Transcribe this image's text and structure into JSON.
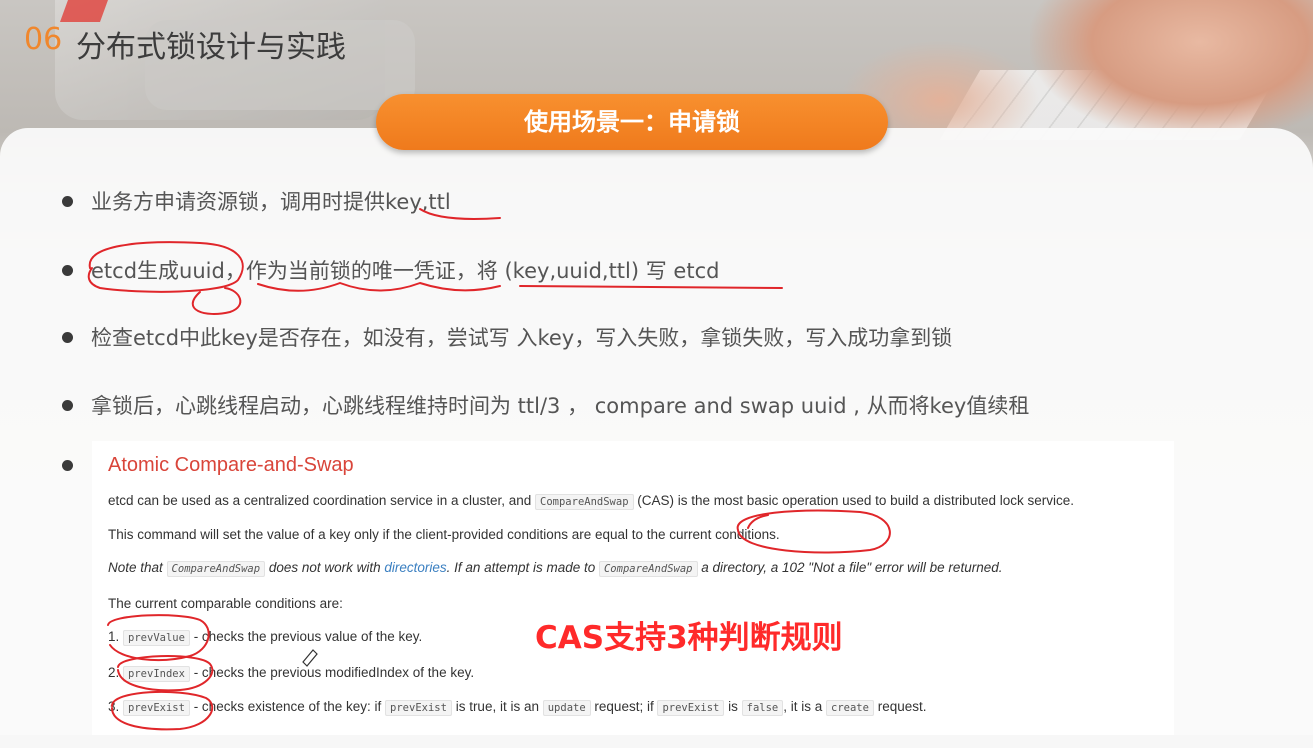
{
  "header": {
    "page_num": "06",
    "title": "分布式锁设计与实践"
  },
  "banner": {
    "label": "使用场景一：申请锁"
  },
  "bullets": [
    "业务方申请资源锁，调用时提供key,ttl",
    "etcd生成uuid，作为当前锁的唯一凭证，将 (key,uuid,ttl) 写 etcd",
    "检查etcd中此key是否存在，如没有，尝试写 入key，写入失败，拿锁失败，写入成功拿到锁",
    "拿锁后，心跳线程启动，心跳线程维持时间为 ttl/3 ， compare and swap uuid , 从而将key值续租"
  ],
  "doc": {
    "title": "Atomic Compare-and-Swap",
    "line1": {
      "pre": "etcd can be used as a centralized coordination service in a cluster, and ",
      "code": "CompareAndSwap",
      "post": " (CAS) is the most basic operation used to build a distributed lock service."
    },
    "line2": "This command will set the value of a key only if the client-provided conditions are equal to the current conditions.",
    "line3": {
      "a": "Note that ",
      "code1": "CompareAndSwap",
      "b": " does not work with ",
      "link": "directories",
      "c": ". If an attempt is made to ",
      "code2": "CompareAndSwap",
      "d": " a directory, a 102 \"Not a file\" error will be returned."
    },
    "line4": "The current comparable conditions are:",
    "items": [
      {
        "num": "1.",
        "code": "prevValue",
        "text": " - checks the previous value of the key."
      },
      {
        "num": "2.",
        "code": "prevIndex",
        "text": " - checks the previous modifiedIndex of the key."
      },
      {
        "num": "3.",
        "code": "prevExist",
        "text": " - checks existence of the key: if ",
        "c1": "prevExist",
        "t2": " is true, it is an ",
        "c2": "update",
        "t3": " request; if ",
        "c3": "prevExist",
        "t4": " is ",
        "c4": "false",
        "t5": ", it is a ",
        "c5": "create",
        "t6": " request."
      }
    ]
  },
  "overlay_note": "CAS支持3种判断规则",
  "colors": {
    "accent": "#f0872d",
    "annotation": "#e0262a",
    "doc_title": "#d9453a"
  }
}
